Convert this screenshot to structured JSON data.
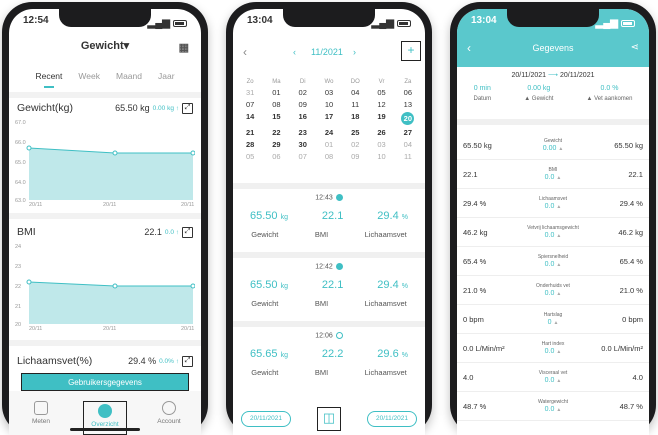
{
  "phone1": {
    "time": "12:54",
    "title": "Gewicht",
    "tabs": [
      "Recent",
      "Week",
      "Maand",
      "Jaar"
    ],
    "weight": {
      "label": "Gewicht(kg)",
      "value": "65.50 kg",
      "delta": "0.00 kg ↑",
      "y_ticks": [
        "67.0",
        "66.0",
        "65.0",
        "64.0",
        "63.0"
      ],
      "x_ticks": [
        "20/11",
        "20/11",
        "20/11"
      ]
    },
    "bmi": {
      "label": "BMI",
      "value": "22.1",
      "delta": "0.0 ↑",
      "y_ticks": [
        "24",
        "23",
        "22",
        "21",
        "20"
      ],
      "x_ticks": [
        "20/11",
        "20/11",
        "20/11"
      ]
    },
    "fat": {
      "label": "Lichaamsvet(%)",
      "value": "29.4 %",
      "delta": "0.0% ↑"
    },
    "banner": "Gebruikersgegevens",
    "nav": [
      "Meten",
      "Overzicht",
      "Account"
    ]
  },
  "phone2": {
    "time": "13:04",
    "month": "11/2021",
    "dow": [
      "Zo",
      "Ma",
      "Di",
      "Wo",
      "DO",
      "Vr",
      "Za"
    ],
    "weeks": [
      [
        "31",
        "01",
        "02",
        "03",
        "04",
        "05",
        "06"
      ],
      [
        "07",
        "08",
        "09",
        "10",
        "11",
        "12",
        "13"
      ],
      [
        "14",
        "15",
        "16",
        "17",
        "18",
        "19",
        "20"
      ],
      [
        "21",
        "22",
        "23",
        "24",
        "25",
        "26",
        "27"
      ],
      [
        "28",
        "29",
        "30",
        "01",
        "02",
        "03",
        "04"
      ],
      [
        "05",
        "06",
        "07",
        "08",
        "09",
        "10",
        "11"
      ]
    ],
    "records": [
      {
        "time": "12:43",
        "weight": "65.50",
        "unit": "kg",
        "bmi": "22.1",
        "fat": "29.4",
        "pct": "%"
      },
      {
        "time": "12:42",
        "weight": "65.50",
        "unit": "kg",
        "bmi": "22.1",
        "fat": "29.4",
        "pct": "%"
      },
      {
        "time": "12:06",
        "weight": "65.65",
        "unit": "kg",
        "bmi": "22.2",
        "fat": "29.6",
        "pct": "%"
      }
    ],
    "labels": {
      "weight": "Gewicht",
      "bmi": "BMI",
      "fat": "Lichaamsvet"
    },
    "from": "20/11/2021",
    "to": "20/11/2021"
  },
  "phone3": {
    "time": "13:04",
    "title": "Gegevens",
    "from": "20/11/2021",
    "to": "20/11/2021",
    "summary": [
      {
        "value": "0 min",
        "label": "Datum"
      },
      {
        "value": "0.00 kg",
        "label": "▲ Gewicht"
      },
      {
        "value": "0.0 %",
        "label": "▲ Vet aankomen"
      }
    ],
    "rows": [
      {
        "left": "65.50 kg",
        "name": "Gewicht",
        "delta": "0.00",
        "right": "65.50 kg"
      },
      {
        "left": "22.1",
        "name": "BMI",
        "delta": "0.0",
        "right": "22.1"
      },
      {
        "left": "29.4 %",
        "name": "Lichaamsvet",
        "delta": "0.0",
        "right": "29.4 %"
      },
      {
        "left": "46.2 kg",
        "name": "Vetvrij lichaamsgewicht",
        "delta": "0.0",
        "right": "46.2 kg"
      },
      {
        "left": "65.4 %",
        "name": "Spiersnelheid",
        "delta": "0.0",
        "right": "65.4 %"
      },
      {
        "left": "21.0 %",
        "name": "Onderhuids vet",
        "delta": "0.0",
        "right": "21.0 %"
      },
      {
        "left": "0 bpm",
        "name": "Hartslag",
        "delta": "0",
        "right": "0 bpm"
      },
      {
        "left": "0.0 L/Min/m²",
        "name": "Hart index",
        "delta": "0.0",
        "right": "0.0 L/Min/m²"
      },
      {
        "left": "4.0",
        "name": "Visceraal vet",
        "delta": "0.0",
        "right": "4.0"
      },
      {
        "left": "48.7 %",
        "name": "Watergewicht",
        "delta": "0.0",
        "right": "48.7 %"
      }
    ]
  }
}
